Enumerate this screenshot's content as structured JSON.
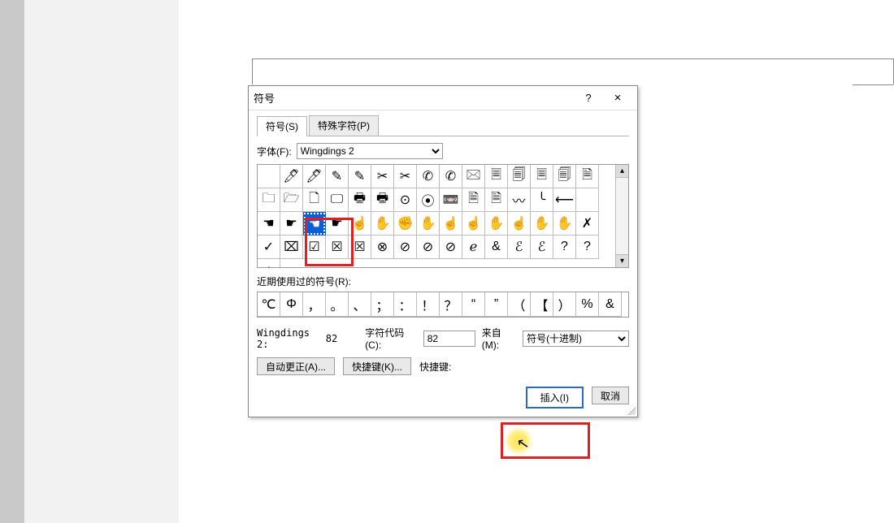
{
  "dialog": {
    "title": "符号",
    "help": "?",
    "close": "×",
    "tabs": {
      "symbols": "符号(S)",
      "special": "特殊字符(P)"
    },
    "font_label": "字体(F):",
    "font_value": "Wingdings 2",
    "recent_label": "近期使用过的符号(R):",
    "unicode_name": {
      "label": "Wingdings 2:",
      "value": "82"
    },
    "char_code_label": "字符代码(C):",
    "char_code_value": "82",
    "from_label": "来自(M):",
    "from_value": "符号(十进制)",
    "autocorrect_btn": "自动更正(A)...",
    "shortcut_btn": "快捷键(K)...",
    "shortcut_label": "快捷键:",
    "insert_btn": "插入(I)",
    "cancel_btn": "取消"
  },
  "grid": {
    "selected_index": 32,
    "glyphs": [
      "",
      "🖊",
      "🖊",
      "✎",
      "✎",
      "✂",
      "✂",
      "✆",
      "✆",
      "🖂",
      "🗏",
      "🗐",
      "🗏",
      "🗐",
      "🗎",
      "🗀",
      "🗁",
      "🗋",
      "🖵",
      "🖶",
      "🖶",
      "⊙",
      "⦿",
      "📼",
      "🗎",
      "🗎",
      "〰",
      "╰",
      "⟵",
      "",
      "☚",
      "☛",
      "☚",
      "☛",
      "☝",
      "✋",
      "✊",
      "✋",
      "☝",
      "☝",
      "✋",
      "☝",
      "✋",
      "✋",
      "✗",
      "✓",
      "⌧",
      "☑",
      "☒",
      "☒",
      "⊗",
      "⊘",
      "⊘",
      "⊘",
      "ℯ",
      "&",
      "ℰ",
      "ℰ",
      "?",
      "?",
      "¿"
    ]
  },
  "recent": {
    "glyphs": [
      "℃",
      "Φ",
      "，",
      "。",
      "、",
      "；",
      "：",
      "！",
      "？",
      "“",
      "”",
      "（",
      "【",
      "）",
      "%",
      "&"
    ]
  }
}
